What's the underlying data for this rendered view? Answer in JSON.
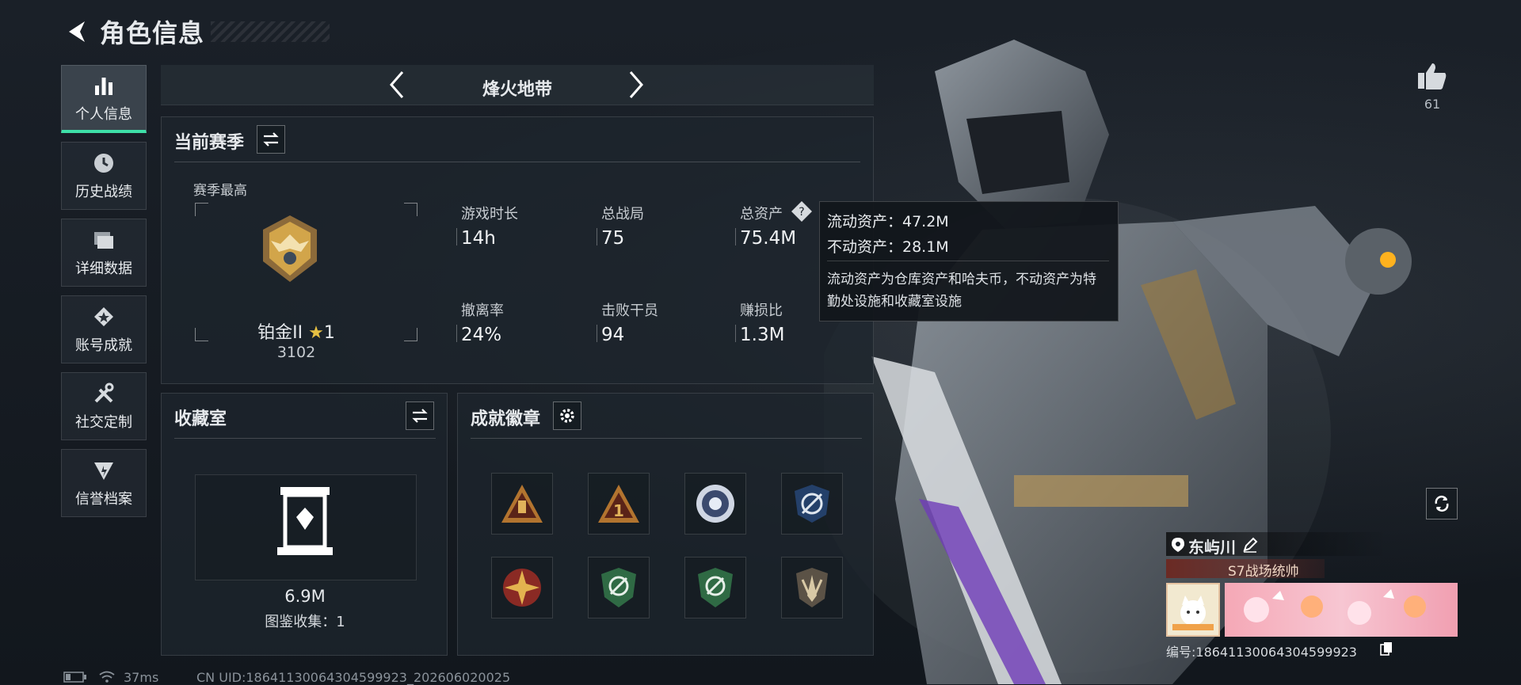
{
  "header": {
    "title": "角色信息"
  },
  "nav": {
    "items": [
      {
        "label": "个人信息",
        "icon": "bar-chart-icon",
        "active": true
      },
      {
        "label": "历史战绩",
        "icon": "clock-icon",
        "active": false
      },
      {
        "label": "详细数据",
        "icon": "folders-icon",
        "active": false
      },
      {
        "label": "账号成就",
        "icon": "medal-icon",
        "active": false
      },
      {
        "label": "社交定制",
        "icon": "tools-icon",
        "active": false
      },
      {
        "label": "信誉档案",
        "icon": "shield-icon",
        "active": false
      }
    ]
  },
  "mode": {
    "label": "烽火地带"
  },
  "season": {
    "title": "当前赛季",
    "best_label": "赛季最高",
    "rank_name": "铂金II",
    "rank_stars": "1",
    "rank_score": "3102",
    "stats": [
      {
        "label": "游戏时长",
        "value": "14h"
      },
      {
        "label": "总战局",
        "value": "75"
      },
      {
        "label": "总资产",
        "value": "75.4M"
      },
      {
        "label": "撤离率",
        "value": "24%"
      },
      {
        "label": "击败干员",
        "value": "94"
      },
      {
        "label": "赚损比",
        "value": "1.3M"
      }
    ]
  },
  "tooltip": {
    "liquid": "流动资产：47.2M",
    "fixed": "不动资产：28.1M",
    "note": "流动资产为仓库资产和哈夫币，不动资产为特勤处设施和收藏室设施"
  },
  "collection": {
    "title": "收藏室",
    "value": "6.9M",
    "catalog": "图鉴收集：1"
  },
  "achievements": {
    "title": "成就徽章",
    "badges": [
      "triangle-badge-icon",
      "rank-one-badge-icon",
      "flower-emblem-badge-icon",
      "crosshair-wings-badge-icon",
      "star-compass-badge-icon",
      "green-shield-badge-icon",
      "green-shield-badge-icon",
      "winged-shield-badge-icon"
    ]
  },
  "likes": {
    "count": "61"
  },
  "player": {
    "name": "东屿川",
    "title_tag": "S7战场统帅",
    "id_text": "编号:18641130064304599923"
  },
  "status": {
    "ping": "37ms",
    "uid": "CN UID:18641130064304599923_202606020025"
  },
  "colors": {
    "accent": "#3ee0a8",
    "gold": "#d2a54a"
  }
}
